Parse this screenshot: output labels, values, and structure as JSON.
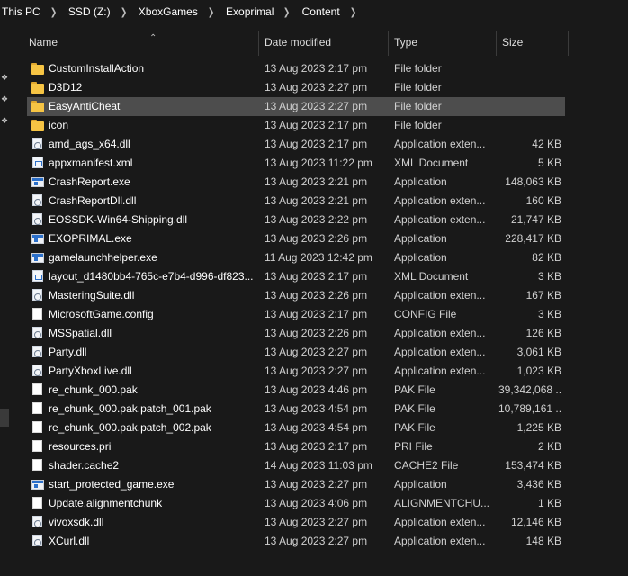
{
  "address_bar": {
    "crumbs": [
      "This PC",
      "SSD (Z:)",
      "XboxGames",
      "Exoprimal",
      "Content"
    ]
  },
  "columns": {
    "name": "Name",
    "date": "Date modified",
    "type": "Type",
    "size": "Size"
  },
  "colors": {
    "background": "#191919",
    "selected_row": "#4d4d4d",
    "folder": "#f6c444",
    "exe_accent": "#2b6fc9"
  },
  "files": [
    {
      "name": "CustomInstallAction",
      "date": "13 Aug 2023 2:17 pm",
      "type": "File folder",
      "size": "",
      "icon": "folder-icon"
    },
    {
      "name": "D3D12",
      "date": "13 Aug 2023 2:27 pm",
      "type": "File folder",
      "size": "",
      "icon": "folder-icon"
    },
    {
      "name": "EasyAntiCheat",
      "date": "13 Aug 2023 2:27 pm",
      "type": "File folder",
      "size": "",
      "icon": "folder-icon",
      "selected": true
    },
    {
      "name": "icon",
      "date": "13 Aug 2023 2:17 pm",
      "type": "File folder",
      "size": "",
      "icon": "folder-icon"
    },
    {
      "name": "amd_ags_x64.dll",
      "date": "13 Aug 2023 2:17 pm",
      "type": "Application exten...",
      "size": "42 KB",
      "icon": "dll-icon"
    },
    {
      "name": "appxmanifest.xml",
      "date": "13 Aug 2023 11:22 pm",
      "type": "XML Document",
      "size": "5 KB",
      "icon": "xml-icon"
    },
    {
      "name": "CrashReport.exe",
      "date": "13 Aug 2023 2:21 pm",
      "type": "Application",
      "size": "148,063 KB",
      "icon": "exe-icon"
    },
    {
      "name": "CrashReportDll.dll",
      "date": "13 Aug 2023 2:21 pm",
      "type": "Application exten...",
      "size": "160 KB",
      "icon": "dll-icon"
    },
    {
      "name": "EOSSDK-Win64-Shipping.dll",
      "date": "13 Aug 2023 2:22 pm",
      "type": "Application exten...",
      "size": "21,747 KB",
      "icon": "dll-icon"
    },
    {
      "name": "EXOPRIMAL.exe",
      "date": "13 Aug 2023 2:26 pm",
      "type": "Application",
      "size": "228,417 KB",
      "icon": "exe-icon"
    },
    {
      "name": "gamelaunchhelper.exe",
      "date": "11 Aug 2023 12:42 pm",
      "type": "Application",
      "size": "82 KB",
      "icon": "exe-icon"
    },
    {
      "name": "layout_d1480bb4-765c-e7b4-d996-df823...",
      "date": "13 Aug 2023 2:17 pm",
      "type": "XML Document",
      "size": "3 KB",
      "icon": "xml-icon"
    },
    {
      "name": "MasteringSuite.dll",
      "date": "13 Aug 2023 2:26 pm",
      "type": "Application exten...",
      "size": "167 KB",
      "icon": "dll-icon"
    },
    {
      "name": "MicrosoftGame.config",
      "date": "13 Aug 2023 2:17 pm",
      "type": "CONFIG File",
      "size": "3 KB",
      "icon": "file-icon"
    },
    {
      "name": "MSSpatial.dll",
      "date": "13 Aug 2023 2:26 pm",
      "type": "Application exten...",
      "size": "126 KB",
      "icon": "dll-icon"
    },
    {
      "name": "Party.dll",
      "date": "13 Aug 2023 2:27 pm",
      "type": "Application exten...",
      "size": "3,061 KB",
      "icon": "dll-icon"
    },
    {
      "name": "PartyXboxLive.dll",
      "date": "13 Aug 2023 2:27 pm",
      "type": "Application exten...",
      "size": "1,023 KB",
      "icon": "dll-icon"
    },
    {
      "name": "re_chunk_000.pak",
      "date": "13 Aug 2023 4:46 pm",
      "type": "PAK File",
      "size": "39,342,068 ...",
      "icon": "file-icon"
    },
    {
      "name": "re_chunk_000.pak.patch_001.pak",
      "date": "13 Aug 2023 4:54 pm",
      "type": "PAK File",
      "size": "10,789,161 ...",
      "icon": "file-icon"
    },
    {
      "name": "re_chunk_000.pak.patch_002.pak",
      "date": "13 Aug 2023 4:54 pm",
      "type": "PAK File",
      "size": "1,225 KB",
      "icon": "file-icon"
    },
    {
      "name": "resources.pri",
      "date": "13 Aug 2023 2:17 pm",
      "type": "PRI File",
      "size": "2 KB",
      "icon": "file-icon"
    },
    {
      "name": "shader.cache2",
      "date": "14 Aug 2023 11:03 pm",
      "type": "CACHE2 File",
      "size": "153,474 KB",
      "icon": "file-icon"
    },
    {
      "name": "start_protected_game.exe",
      "date": "13 Aug 2023 2:27 pm",
      "type": "Application",
      "size": "3,436 KB",
      "icon": "exe-icon"
    },
    {
      "name": "Update.alignmentchunk",
      "date": "13 Aug 2023 4:06 pm",
      "type": "ALIGNMENTCHU...",
      "size": "1 KB",
      "icon": "file-icon"
    },
    {
      "name": "vivoxsdk.dll",
      "date": "13 Aug 2023 2:27 pm",
      "type": "Application exten...",
      "size": "12,146 KB",
      "icon": "dll-icon"
    },
    {
      "name": "XCurl.dll",
      "date": "13 Aug 2023 2:27 pm",
      "type": "Application exten...",
      "size": "148 KB",
      "icon": "dll-icon"
    }
  ]
}
